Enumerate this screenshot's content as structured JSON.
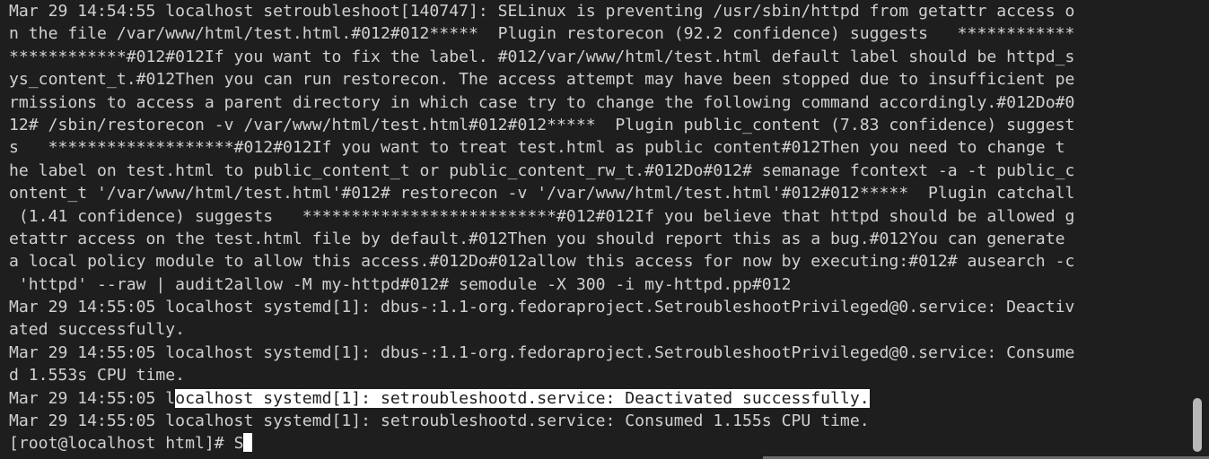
{
  "terminal": {
    "lines": [
      "Mar 29 14:54:55 localhost setroubleshoot[140747]: SELinux is preventing /usr/sbin/httpd from getattr access o",
      "n the file /var/www/html/test.html.#012#012*****  Plugin restorecon (92.2 confidence) suggests   ************",
      "************#012#012If you want to fix the label. #012/var/www/html/test.html default label should be httpd_s",
      "ys_content_t.#012Then you can run restorecon. The access attempt may have been stopped due to insufficient pe",
      "rmissions to access a parent directory in which case try to change the following command accordingly.#012Do#0",
      "12# /sbin/restorecon -v /var/www/html/test.html#012#012*****  Plugin public_content (7.83 confidence) suggest",
      "s   *******************#012#012If you want to treat test.html as public content#012Then you need to change t",
      "he label on test.html to public_content_t or public_content_rw_t.#012Do#012# semanage fcontext -a -t public_c",
      "ontent_t '/var/www/html/test.html'#012# restorecon -v '/var/www/html/test.html'#012#012*****  Plugin catchall",
      " (1.41 confidence) suggests   **************************#012#012If you believe that httpd should be allowed g",
      "etattr access on the test.html file by default.#012Then you should report this as a bug.#012You can generate ",
      "a local policy module to allow this access.#012Do#012allow this access for now by executing:#012# ausearch -c",
      " 'httpd' --raw | audit2allow -M my-httpd#012# semodule -X 300 -i my-httpd.pp#012",
      "Mar 29 14:55:05 localhost systemd[1]: dbus-:1.1-org.fedoraproject.SetroubleshootPrivileged@0.service: Deactiv",
      "ated successfully.",
      "Mar 29 14:55:05 localhost systemd[1]: dbus-:1.1-org.fedoraproject.SetroubleshootPrivileged@0.service: Consume",
      "d 1.553s CPU time."
    ],
    "highlight_line": {
      "before": "Mar 29 14:55:05 l",
      "selected": "ocalhost systemd[1]: setroubleshootd.service: Deactivated successfully."
    },
    "after_lines": [
      "Mar 29 14:55:05 localhost systemd[1]: setroubleshootd.service: Consumed 1.155s CPU time."
    ],
    "prompt": "[root@localhost html]# ",
    "input": "S"
  }
}
